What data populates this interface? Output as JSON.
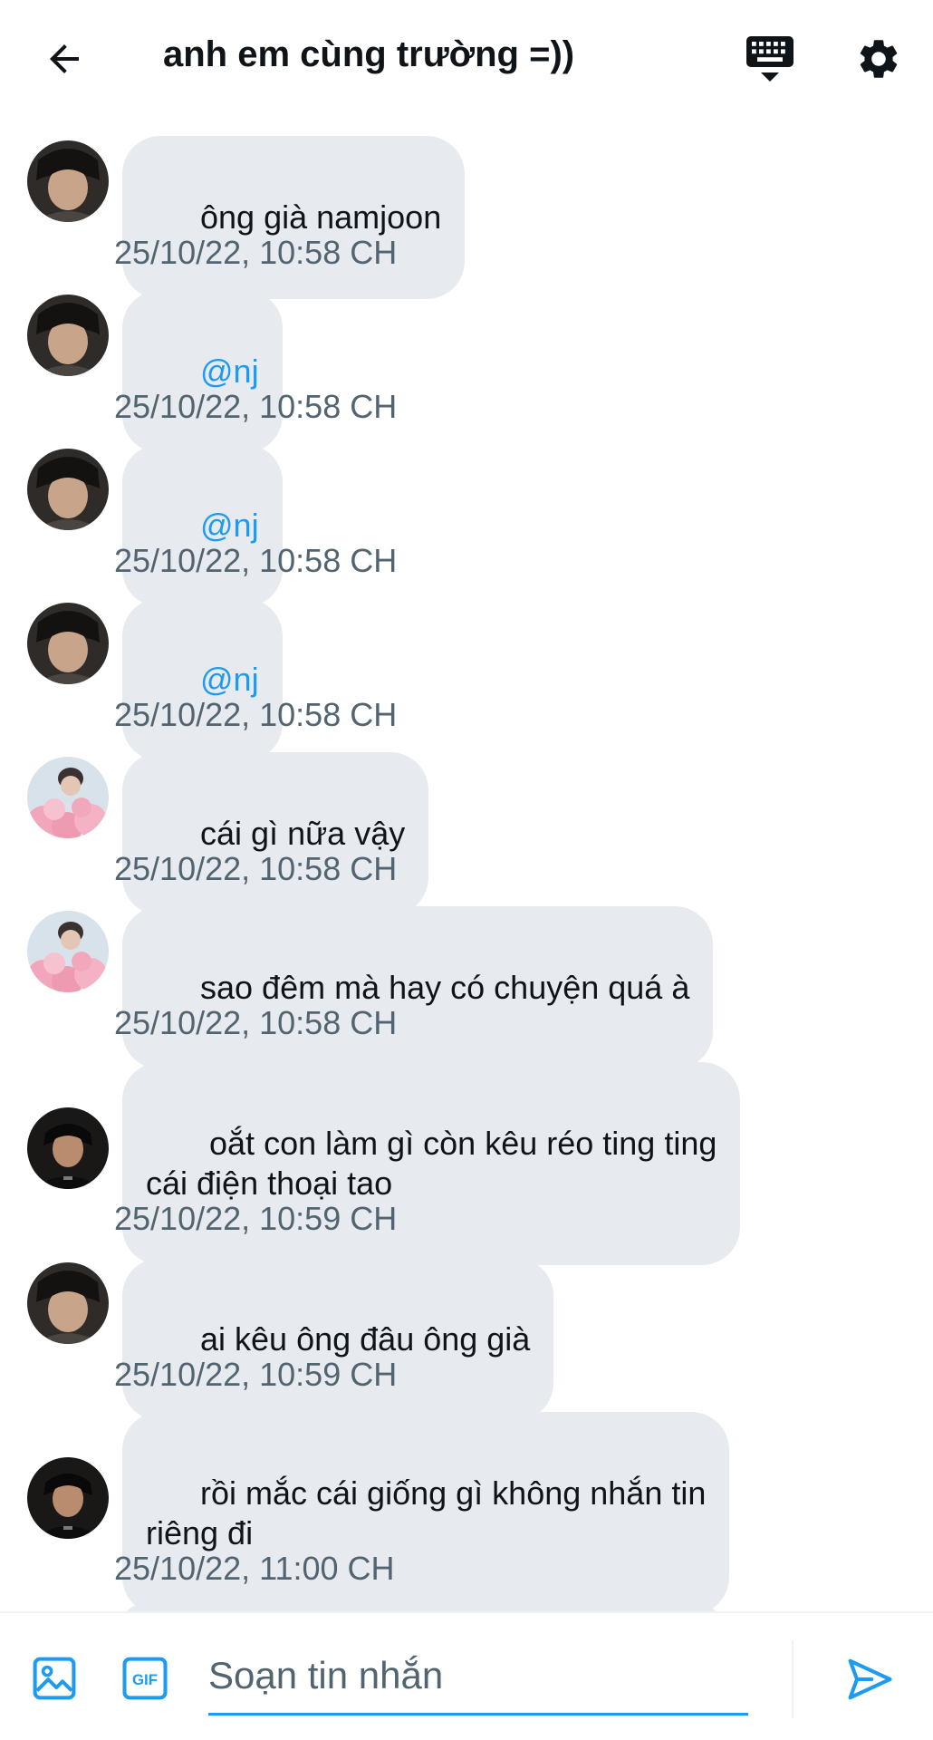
{
  "header": {
    "title": "anh em cùng trường =))",
    "back_icon": "arrow-left-icon",
    "keyboard_icon": "keyboard-icon",
    "settings_icon": "gear-icon"
  },
  "colors": {
    "accent": "#1d9bf0",
    "bubble": "#e7ebef",
    "text": "#0f1419",
    "muted": "#536471"
  },
  "messages": [
    {
      "text": "ông già namjoon",
      "mention": false,
      "time": "25/10/22, 10:58 CH",
      "sender": "jk"
    },
    {
      "text": "@nj",
      "mention": true,
      "time": "25/10/22, 10:58 CH",
      "sender": "jk"
    },
    {
      "text": "@nj",
      "mention": true,
      "time": "25/10/22, 10:58 CH",
      "sender": "jk"
    },
    {
      "text": "@nj",
      "mention": true,
      "time": "25/10/22, 10:58 CH",
      "sender": "jk"
    },
    {
      "text": "cái gì nữa vậy",
      "mention": false,
      "time": "25/10/22, 10:58 CH",
      "sender": "flowers"
    },
    {
      "text": "sao đêm mà hay có chuyện quá à",
      "mention": false,
      "time": "25/10/22, 10:58 CH",
      "sender": "flowers"
    },
    {
      "text": " oắt con làm gì còn kêu réo ting ting\ncái điện thoại tao",
      "mention": false,
      "time": "25/10/22, 10:59 CH",
      "sender": "nj"
    },
    {
      "text": "ai kêu ông đâu ông già",
      "mention": false,
      "time": "25/10/22, 10:59 CH",
      "sender": "jk"
    },
    {
      "text": "rồi mắc cái giống gì không nhắn tin\nriêng đi",
      "mention": false,
      "time": "25/10/22, 11:00 CH",
      "sender": "nj"
    }
  ],
  "composer": {
    "placeholder": "Soạn tin nhắn",
    "image_icon": "image-icon",
    "gif_label": "GIF",
    "send_icon": "send-icon"
  }
}
